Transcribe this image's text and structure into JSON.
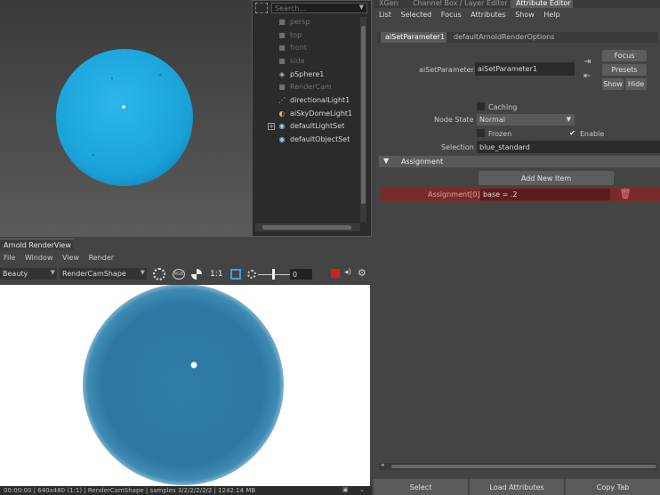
{
  "outliner": {
    "search_placeholder": "Search...",
    "items": [
      {
        "label": "persp",
        "icon": "camera-icon",
        "dim": true
      },
      {
        "label": "top",
        "icon": "camera-icon",
        "dim": true
      },
      {
        "label": "front",
        "icon": "camera-icon",
        "dim": true
      },
      {
        "label": "side",
        "icon": "camera-icon",
        "dim": true
      },
      {
        "label": "pSphere1",
        "icon": "mesh-icon",
        "dim": false
      },
      {
        "label": "RenderCam",
        "icon": "camera-icon",
        "dim": true
      },
      {
        "label": "directionalLight1",
        "icon": "directional-light-icon",
        "dim": false
      },
      {
        "label": "aiSkyDomeLight1",
        "icon": "skydome-light-icon",
        "dim": false
      },
      {
        "label": "defaultLightSet",
        "icon": "set-icon",
        "dim": false
      },
      {
        "label": "defaultObjectSet",
        "icon": "set-icon",
        "dim": false
      }
    ]
  },
  "render_view": {
    "title": "Arnold RenderView",
    "menu": [
      "File",
      "Window",
      "View",
      "Render"
    ],
    "aov": "Beauty",
    "camera": "RenderCamShape",
    "ratio": "1:1",
    "exposure": "0",
    "status": "00:00:00 | 640x480 (1:1) | RenderCamShape | samples 3/2/2/2/2/2 | 1242.14 MB"
  },
  "attribute_editor": {
    "top_tabs": [
      "XGen",
      "Channel Box / Layer Editor",
      "Attribute Editor"
    ],
    "menu": [
      "List",
      "Selected",
      "Focus",
      "Attributes",
      "Show",
      "Help"
    ],
    "node_tabs": [
      "aiSetParameter1",
      "defaultArnoldRenderOptions"
    ],
    "node_label": "aiSetParameter:",
    "node_value": "aiSetParameter1",
    "focus": "Focus",
    "presets": "Presets",
    "show": "Show",
    "hide": "Hide",
    "caching": "Caching",
    "node_state_label": "Node State",
    "node_state_value": "Normal",
    "frozen": "Frozen",
    "enable": "Enable",
    "selection_label": "Selection",
    "selection_value": "blue_standard",
    "section_title": "Assignment",
    "add_item": "Add New Item",
    "assignment_label": "Assignment[0]",
    "assignment_value": "base = .2",
    "bottom_buttons": [
      "Select",
      "Load Attributes",
      "Copy Tab"
    ]
  },
  "colors": {
    "sphere_viewport": "#1fa7dc",
    "sphere_render": "#2e7fa7",
    "assignment_bg": "#7a2a2a",
    "active_tab": "#5a5a5a"
  }
}
